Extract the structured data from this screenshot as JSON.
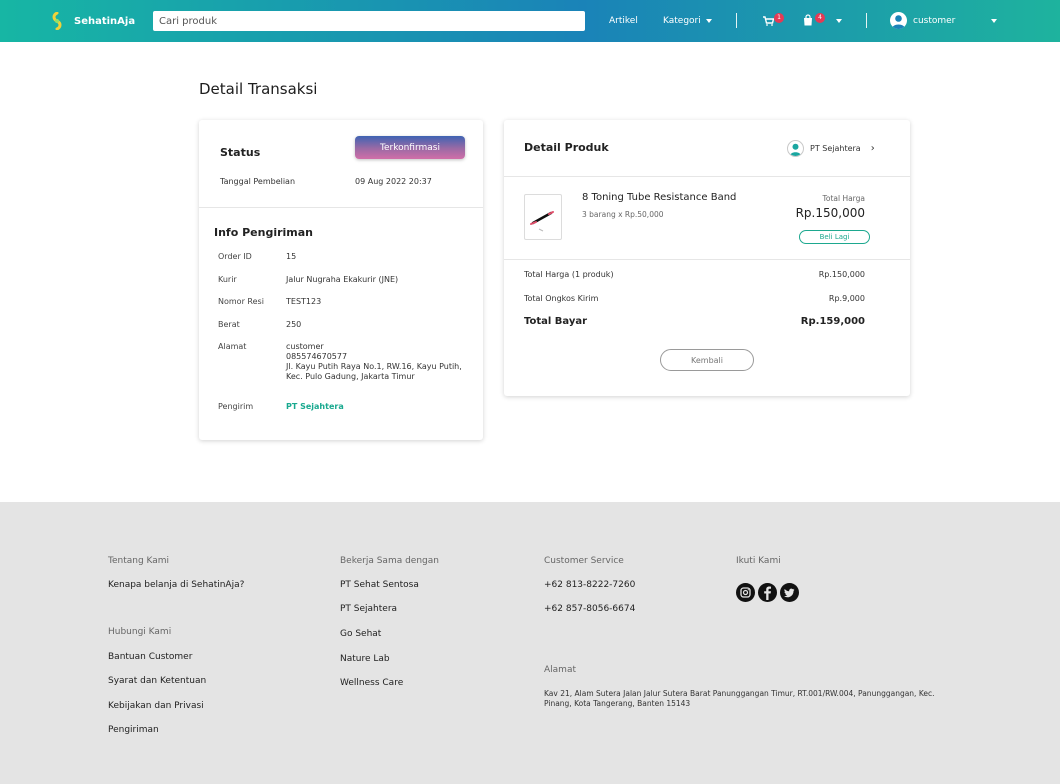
{
  "navbar": {
    "brand": "SehatinAja",
    "search_placeholder": "Cari produk",
    "artikel": "Artikel",
    "kategori": "Kategori",
    "cart_count": "1",
    "bag_count": "4",
    "user": "customer"
  },
  "page": {
    "title": "Detail Transaksi"
  },
  "status_card": {
    "title": "Status",
    "status_label": "Terkonfirmasi",
    "tanggal_label": "Tanggal Pembelian",
    "tanggal_value": "09 Aug 2022 20:37"
  },
  "shipping": {
    "title": "Info Pengiriman",
    "order_id_label": "Order ID",
    "order_id": "15",
    "kurir_label": "Kurir",
    "kurir": "Jalur Nugraha Ekakurir (JNE)",
    "resi_label": "Nomor Resi",
    "resi": "TEST123",
    "berat_label": "Berat",
    "berat": "250",
    "alamat_label": "Alamat",
    "alamat_name": "customer",
    "alamat_phone": "085574670577",
    "alamat_line1": "Jl. Kayu Putih Raya No.1, RW.16, Kayu Putih,",
    "alamat_line2": "Kec. Pulo Gadung, Jakarta Timur",
    "pengirim_label": "Pengirim",
    "pengirim": "PT Sejahtera"
  },
  "detail_produk": {
    "title": "Detail Produk",
    "seller": "PT Sejahtera",
    "product_name": "8 Toning Tube Resistance Band",
    "product_qty": "3 barang x Rp.50,000",
    "total_harga_label": "Total Harga",
    "total_harga": "Rp.150,000",
    "beli_lagi": "Beli Lagi",
    "summary_total_label": "Total Harga (1 produk)",
    "summary_total": "Rp.150,000",
    "ongkir_label": "Total Ongkos Kirim",
    "ongkir": "Rp.9,000",
    "bayar_label": "Total Bayar",
    "bayar": "Rp.159,000",
    "kembali": "Kembali"
  },
  "footer": {
    "tentang_head": "Tentang Kami",
    "tentang_item": "Kenapa belanja di SehatinAja?",
    "hubungi_head": "Hubungi Kami",
    "hubungi_items": [
      "Bantuan Customer",
      "Syarat dan Ketentuan",
      "Kebijakan dan Privasi",
      "Pengiriman"
    ],
    "partner_head": "Bekerja Sama dengan",
    "partner_items": [
      "PT Sehat Sentosa",
      "PT Sejahtera",
      "Go Sehat",
      "Nature Lab",
      "Wellness Care"
    ],
    "cs_head": "Customer Service",
    "cs_phones": [
      "+62 813-8222-7260",
      "+62 857-8056-6674"
    ],
    "alamat_head": "Alamat",
    "alamat": "Kav 21, Alam Sutera Jalan Jalur Sutera Barat Panunggangan Timur, RT.001/RW.004, Panunggangan, Kec. Pinang, Kota Tangerang, Banten 15143",
    "ikuti_head": "Ikuti Kami",
    "social_icons": [
      "instagram-icon",
      "facebook-icon",
      "twitter-icon"
    ]
  },
  "colors": {
    "accent": "#1da88f",
    "badge": "#e53a55",
    "footer_bg": "#e4e4e4"
  }
}
